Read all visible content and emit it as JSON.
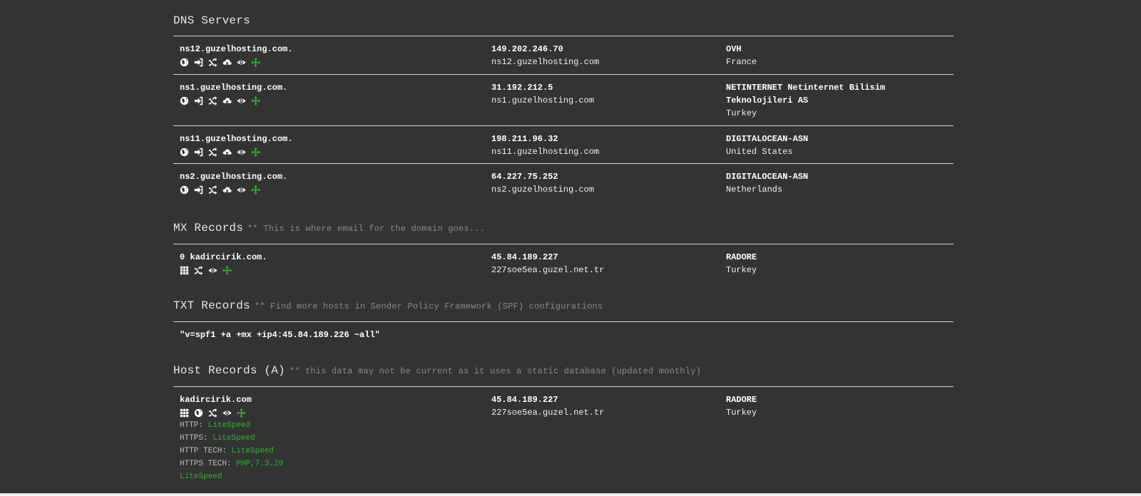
{
  "dns": {
    "title": "DNS Servers",
    "rows": [
      {
        "host": "ns12.guzelhosting.com.",
        "ip": "149.202.246.70",
        "rdns": "ns12.guzelhosting.com",
        "asn": [
          "OVH"
        ],
        "country": "France"
      },
      {
        "host": "ns1.guzelhosting.com.",
        "ip": "31.192.212.5",
        "rdns": "ns1.guzelhosting.com",
        "asn": [
          "NETINTERNET Netinternet Bilisim",
          "Teknolojileri AS"
        ],
        "country": "Turkey"
      },
      {
        "host": "ns11.guzelhosting.com.",
        "ip": "198.211.96.32",
        "rdns": "ns11.guzelhosting.com",
        "asn": [
          "DIGITALOCEAN-ASN"
        ],
        "country": "United States"
      },
      {
        "host": "ns2.guzelhosting.com.",
        "ip": "64.227.75.252",
        "rdns": "ns2.guzelhosting.com",
        "asn": [
          "DIGITALOCEAN-ASN"
        ],
        "country": "Netherlands"
      }
    ]
  },
  "mx": {
    "title": "MX Records",
    "note": "** This is where email for the domain goes...",
    "rows": [
      {
        "host": "0 kadircirik.com.",
        "ip": "45.84.189.227",
        "rdns": "227soe5ea.guzel.net.tr",
        "asn": "RADORE",
        "country": "Turkey"
      }
    ]
  },
  "txt": {
    "title": "TXT Records",
    "note": "** Find more hosts in Sender Policy Framework (SPF) configurations",
    "value": "\"v=spf1 +a +mx +ip4:45.84.189.226 ~all\""
  },
  "hosts": {
    "title": "Host Records (A)",
    "note": "** this data may not be current as it uses a static database (updated monthly)",
    "rows": [
      {
        "host": "kadircirik.com",
        "ip": "45.84.189.227",
        "rdns": "227soe5ea.guzel.net.tr",
        "asn": "RADORE",
        "country": "Turkey",
        "http_label": "HTTP:",
        "http": "LiteSpeed",
        "https_label": "HTTPS:",
        "https": "LiteSpeed",
        "http_tech_label": "HTTP TECH:",
        "http_tech": "LiteSpeed",
        "https_tech_label": "HTTPS TECH:",
        "https_tech": "PHP,7.3.20",
        "https_tech_2": "LiteSpeed"
      }
    ]
  },
  "icons": {
    "dns": [
      "globe-icon",
      "sign-in-icon",
      "shuffle-icon",
      "cloud-upload-icon",
      "eye-icon",
      "expand-arrows-icon"
    ],
    "mx": [
      "grid-icon",
      "shuffle-icon",
      "eye-icon",
      "expand-arrows-icon"
    ],
    "host": [
      "grid-icon",
      "globe-icon",
      "shuffle-icon",
      "eye-icon",
      "expand-arrows-icon"
    ]
  },
  "colors": {
    "background": "#333333",
    "text": "#ffffff",
    "note": "#8a8a8a",
    "accent_green": "#2cb52c",
    "rule": "#d8d8d8"
  }
}
